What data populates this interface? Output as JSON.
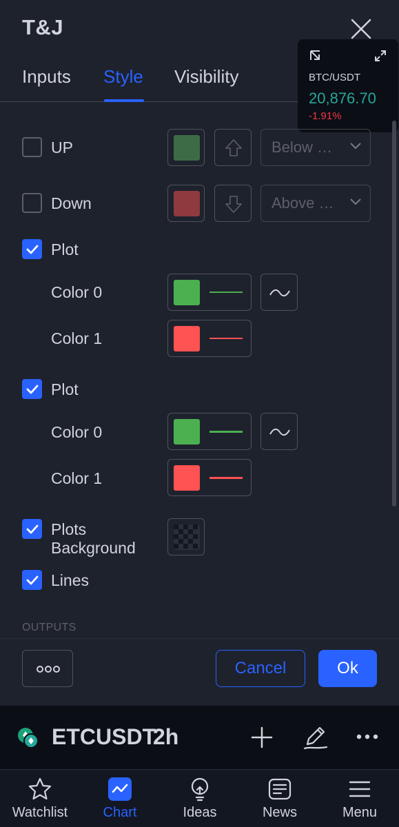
{
  "dialog": {
    "title": "T&J",
    "tabs": [
      {
        "label": "Inputs",
        "active": false
      },
      {
        "label": "Style",
        "active": true
      },
      {
        "label": "Visibility",
        "active": false
      }
    ],
    "rows": {
      "up": {
        "label": "UP",
        "checked": false,
        "color": "#3d6b45",
        "select": "Below …"
      },
      "down": {
        "label": "Down",
        "checked": false,
        "color": "#8e3a3f",
        "select": "Above …"
      },
      "plot1": {
        "label": "Plot",
        "checked": true,
        "color0": {
          "label": "Color 0",
          "color": "#4caf50"
        },
        "color1": {
          "label": "Color 1",
          "color": "#ff5252"
        }
      },
      "plot2": {
        "label": "Plot",
        "checked": true,
        "color0": {
          "label": "Color 0",
          "color": "#4caf50"
        },
        "color1": {
          "label": "Color 1",
          "color": "#ff5252"
        }
      },
      "plots_background": {
        "label_line1": "Plots",
        "label_line2": "Background",
        "checked": true
      },
      "lines": {
        "label": "Lines",
        "checked": true
      }
    },
    "section_outputs": "OUTPUTS",
    "buttons": {
      "more": "more-options",
      "cancel": "Cancel",
      "ok": "Ok"
    }
  },
  "ticker": {
    "symbol": "BTC/USDT",
    "price": "20,876.70",
    "change": "-1.91%"
  },
  "symbol_bar": {
    "symbol": "ETCUSDT",
    "interval": "2h"
  },
  "bottom_nav": [
    {
      "label": "Watchlist",
      "icon": "star-icon",
      "active": false
    },
    {
      "label": "Chart",
      "icon": "chart-icon",
      "active": true
    },
    {
      "label": "Ideas",
      "icon": "lightbulb-icon",
      "active": false
    },
    {
      "label": "News",
      "icon": "news-icon",
      "active": false
    },
    {
      "label": "Menu",
      "icon": "hamburger-menu-icon",
      "active": false
    }
  ],
  "colors": {
    "accent": "#2962ff",
    "background": "#1e222d",
    "positive": "#26a69a",
    "negative": "#f23645"
  }
}
